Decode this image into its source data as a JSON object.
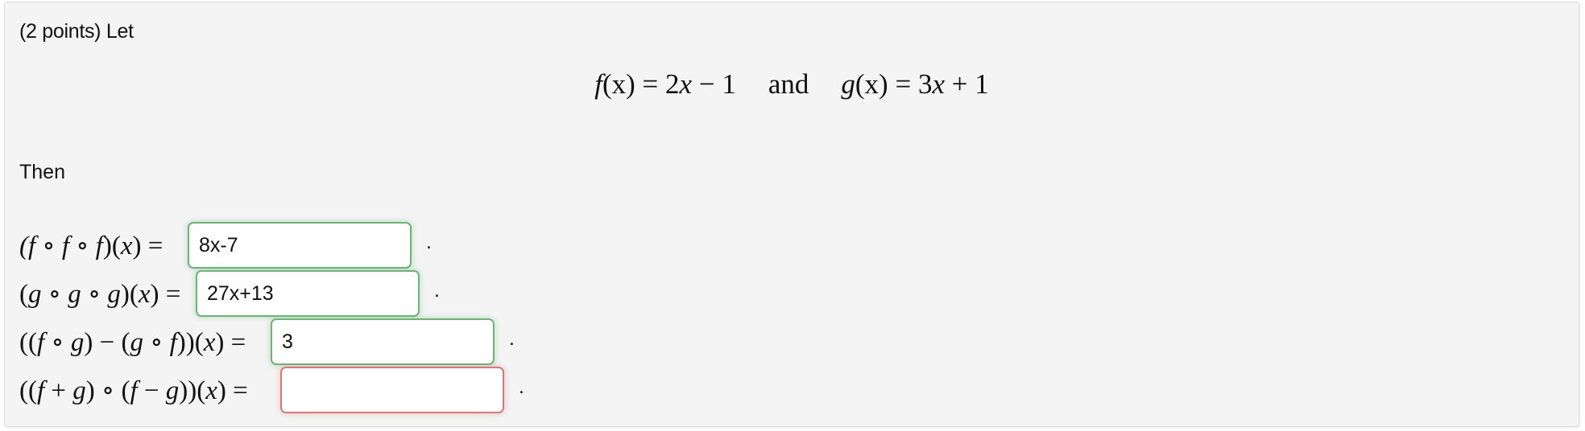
{
  "problem": {
    "intro": "(2 points) Let",
    "definitions": {
      "f_lhs": "f",
      "f_arg": "(x) = 2",
      "f_var": "x",
      "f_rest": " − 1",
      "connector": "and",
      "g_lhs": "g",
      "g_arg": "(x) = 3",
      "g_var": "x",
      "g_rest": " + 1"
    },
    "then_label": "Then",
    "parts": [
      {
        "expression": "(f ∘ f ∘ f)(x) =",
        "answer": "8x-7",
        "status": "correct",
        "trailing": "."
      },
      {
        "expression": "(g ∘ g ∘ g)(x) =",
        "answer": "27x+13",
        "status": "correct",
        "trailing": "."
      },
      {
        "expression": "((f ∘ g) − (g ∘ f))(x) =",
        "answer": "3",
        "status": "correct",
        "trailing": "."
      },
      {
        "expression": "((f + g) ∘ (f − g))(x) =",
        "answer": "",
        "status": "incorrect",
        "trailing": "."
      }
    ]
  },
  "colors": {
    "background": "#f4f4f4",
    "correct_border": "#6fb37a",
    "incorrect_border": "#d57a7a"
  }
}
